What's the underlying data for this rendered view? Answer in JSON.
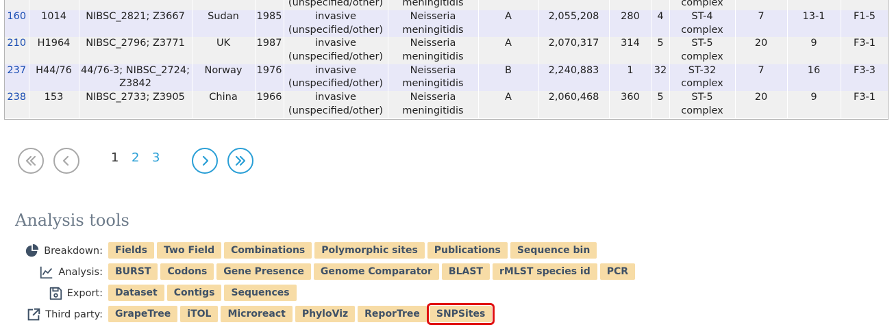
{
  "table": {
    "partial_row": {
      "cells": [
        "",
        "",
        "",
        "",
        "",
        "(unspecified/other)",
        "meningitidis",
        "",
        "",
        "",
        "",
        "complex",
        "",
        "",
        ""
      ]
    },
    "rows": [
      {
        "id": "160",
        "isolate": "1014",
        "aliases": [
          "NIBSC_2821; Z3667"
        ],
        "country": "Sudan",
        "year": "1985",
        "disease": [
          "invasive",
          "(unspecified/other)"
        ],
        "species": [
          "Neisseria",
          "meningitidis"
        ],
        "serogroup": "A",
        "length": "2,055,208",
        "st": "280",
        "n": "4",
        "clonal_complex": [
          "ST-4",
          "complex"
        ],
        "c1": "7",
        "c2": "13-1",
        "c3": "F1-5"
      },
      {
        "id": "210",
        "isolate": "H1964",
        "aliases": [
          "NIBSC_2796; Z3771"
        ],
        "country": "UK",
        "year": "1987",
        "disease": [
          "invasive",
          "(unspecified/other)"
        ],
        "species": [
          "Neisseria",
          "meningitidis"
        ],
        "serogroup": "A",
        "length": "2,070,317",
        "st": "314",
        "n": "5",
        "clonal_complex": [
          "ST-5",
          "complex"
        ],
        "c1": "20",
        "c2": "9",
        "c3": "F3-1"
      },
      {
        "id": "237",
        "isolate": "H44/76",
        "aliases": [
          "44/76-3; NIBSC_2724;",
          "Z3842"
        ],
        "country": "Norway",
        "year": "1976",
        "disease": [
          "invasive",
          "(unspecified/other)"
        ],
        "species": [
          "Neisseria",
          "meningitidis"
        ],
        "serogroup": "B",
        "length": "2,240,883",
        "st": "1",
        "n": "32",
        "clonal_complex": [
          "ST-32",
          "complex"
        ],
        "c1": "7",
        "c2": "16",
        "c3": "F3-3"
      },
      {
        "id": "238",
        "isolate": "153",
        "aliases": [
          "NIBSC_2733; Z3905"
        ],
        "country": "China",
        "year": "1966",
        "disease": [
          "invasive",
          "(unspecified/other)"
        ],
        "species": [
          "Neisseria",
          "meningitidis"
        ],
        "serogroup": "A",
        "length": "2,060,468",
        "st": "360",
        "n": "5",
        "clonal_complex": [
          "ST-5",
          "complex"
        ],
        "c1": "20",
        "c2": "9",
        "c3": "F3-1"
      }
    ]
  },
  "pagination": {
    "pages": [
      "1",
      "2",
      "3"
    ],
    "current": "1",
    "icons": {
      "first": "double-chevron-left-icon",
      "prev": "chevron-left-icon",
      "next": "chevron-right-icon",
      "last": "double-chevron-right-icon"
    }
  },
  "analysis_tools": {
    "title": "Analysis tools",
    "rows": [
      {
        "label": "Breakdown:",
        "icon": "pie-chart-icon",
        "tools": [
          "Fields",
          "Two Field",
          "Combinations",
          "Polymorphic sites",
          "Publications",
          "Sequence bin"
        ]
      },
      {
        "label": "Analysis:",
        "icon": "line-chart-icon",
        "tools": [
          "BURST",
          "Codons",
          "Gene Presence",
          "Genome Comparator",
          "BLAST",
          "rMLST species id",
          "PCR"
        ]
      },
      {
        "label": "Export:",
        "icon": "save-icon",
        "tools": [
          "Dataset",
          "Contigs",
          "Sequences"
        ]
      },
      {
        "label": "Third party:",
        "icon": "external-link-icon",
        "tools": [
          "GrapeTree",
          "iTOL",
          "Microreact",
          "PhyloViz",
          "ReporTree",
          "SNPSites"
        ]
      }
    ],
    "highlighted_tool": "SNPSites"
  },
  "colors": {
    "tool_bg": "#f7dca6",
    "tool_text": "#3f5166",
    "highlight": "#e01010",
    "link": "#2a9fd6",
    "row_odd": "#f0f0f0",
    "row_even": "#e8e8f8"
  }
}
